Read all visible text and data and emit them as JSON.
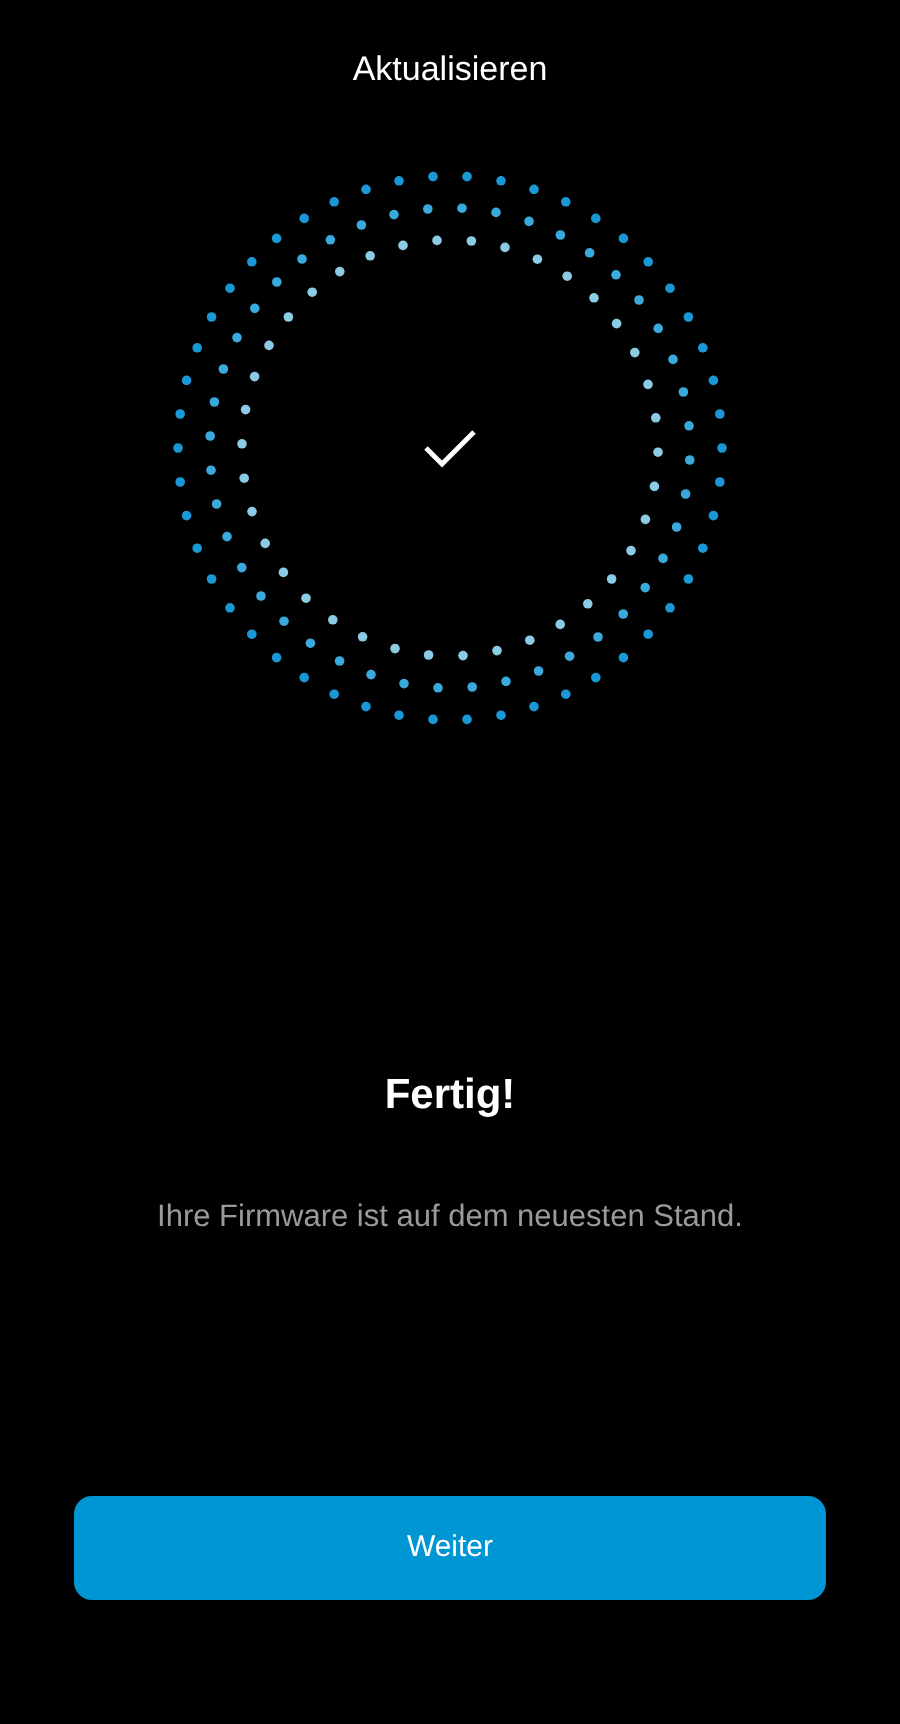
{
  "header": {
    "title": "Aktualisieren"
  },
  "status": {
    "complete": true,
    "heading": "Fertig!",
    "message": "Ihre Firmware ist auf dem neuesten Stand."
  },
  "buttons": [
    {
      "label": "Weiter"
    }
  ]
}
